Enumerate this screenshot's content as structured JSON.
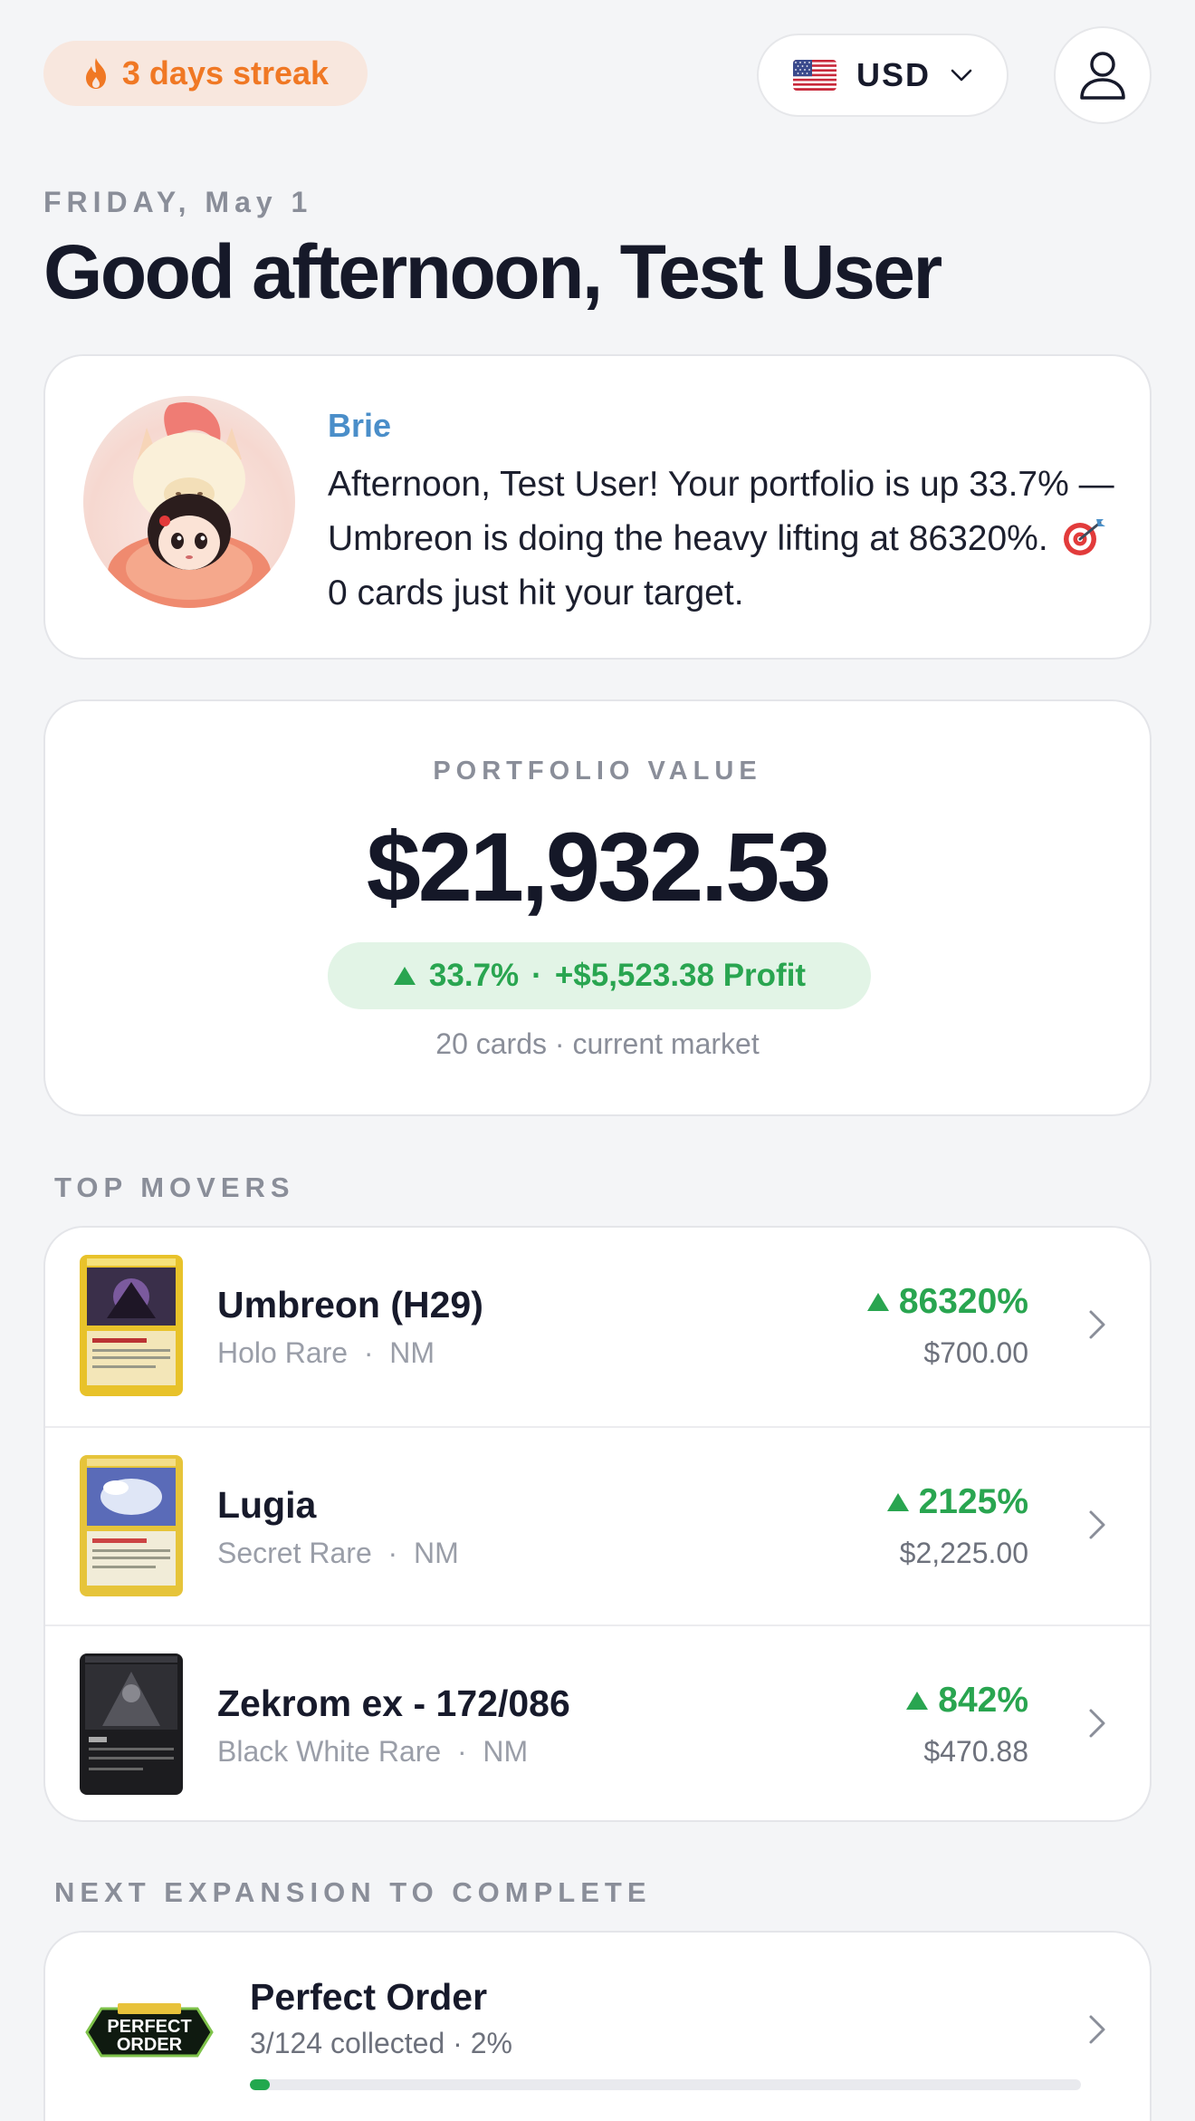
{
  "header": {
    "streak_label": "3 days streak",
    "currency_code": "USD",
    "accent_color": "#f07824"
  },
  "greeting": {
    "date": "FRIDAY, May 1",
    "title": "Good afternoon, Test User"
  },
  "assistant": {
    "name": "Brie",
    "message_part1": "Afternoon, Test User! Your portfolio is up 33.7% — Umbreon is doing the heavy lifting at 86320%.",
    "message_part2": "0 cards just hit your target.",
    "icon": "dart-target-icon"
  },
  "portfolio": {
    "label": "PORTFOLIO VALUE",
    "value": "$21,932.53",
    "change_pct": "33.7%",
    "separator": "·",
    "profit": "+$5,523.38 Profit",
    "subtext": "20 cards · current market",
    "positive_color": "#29a550"
  },
  "top_movers": {
    "label": "TOP MOVERS",
    "items": [
      {
        "name": "Umbreon (H29)",
        "rarity": "Holo Rare",
        "condition": "NM",
        "change": "86320%",
        "price": "$700.00"
      },
      {
        "name": "Lugia",
        "rarity": "Secret Rare",
        "condition": "NM",
        "change": "2125%",
        "price": "$2,225.00"
      },
      {
        "name": "Zekrom ex - 172/086",
        "rarity": "Black White Rare",
        "condition": "NM",
        "change": "842%",
        "price": "$470.88"
      }
    ]
  },
  "next_expansion": {
    "label": "NEXT EXPANSION TO COMPLETE",
    "name": "Perfect Order",
    "progress_text": "3/124 collected · 2%",
    "progress_fraction": 0.024
  }
}
